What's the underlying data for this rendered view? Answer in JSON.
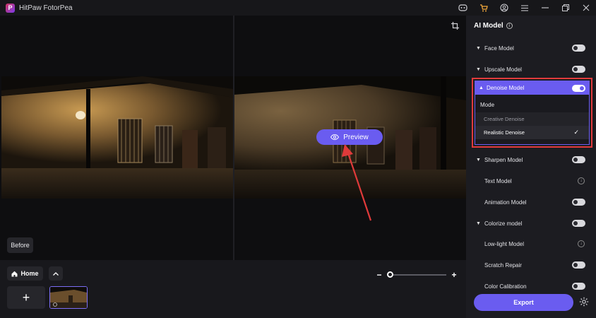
{
  "app": {
    "title": "HitPaw FotorPea",
    "logo_letter": "P"
  },
  "titlebar": {
    "icons": [
      "discord-icon",
      "cart-icon",
      "account-icon",
      "menu-icon",
      "minimize-icon",
      "restore-icon",
      "close-icon"
    ]
  },
  "canvas": {
    "preview_label": "Preview",
    "before_label": "Before"
  },
  "bottombar": {
    "home_label": "Home",
    "add_label": "+",
    "zoom_minus": "−",
    "zoom_plus": "+",
    "zoom_level": 0
  },
  "panel": {
    "title": "AI Model",
    "models": [
      {
        "label": "Face Model",
        "kind": "section",
        "toggle": "off"
      },
      {
        "label": "Upscale Model",
        "kind": "section",
        "toggle": "off"
      }
    ],
    "denoise": {
      "label": "Denoise Model",
      "toggle": "on",
      "mode_label": "Mode",
      "options": [
        {
          "label": "Creative Denoise",
          "selected": false
        },
        {
          "label": "Realistic Denoise",
          "selected": true
        }
      ]
    },
    "more_models": [
      {
        "label": "Sharpen Model",
        "kind": "section",
        "toggle": "off"
      },
      {
        "label": "Text Model",
        "kind": "sub",
        "control": "download"
      },
      {
        "label": "Animation Model",
        "kind": "sub",
        "toggle": "off"
      },
      {
        "label": "Colorize model",
        "kind": "section",
        "toggle": "off"
      },
      {
        "label": "Low-light Model",
        "kind": "sub",
        "control": "download"
      },
      {
        "label": "Scratch Repair",
        "kind": "sub",
        "toggle": "off"
      },
      {
        "label": "Color Calibration",
        "kind": "sub",
        "toggle": "off"
      }
    ],
    "export_label": "Export"
  },
  "colors": {
    "accent": "#6a5cf0",
    "highlight": "#e03a3a",
    "arrow": "#e03a3a"
  }
}
